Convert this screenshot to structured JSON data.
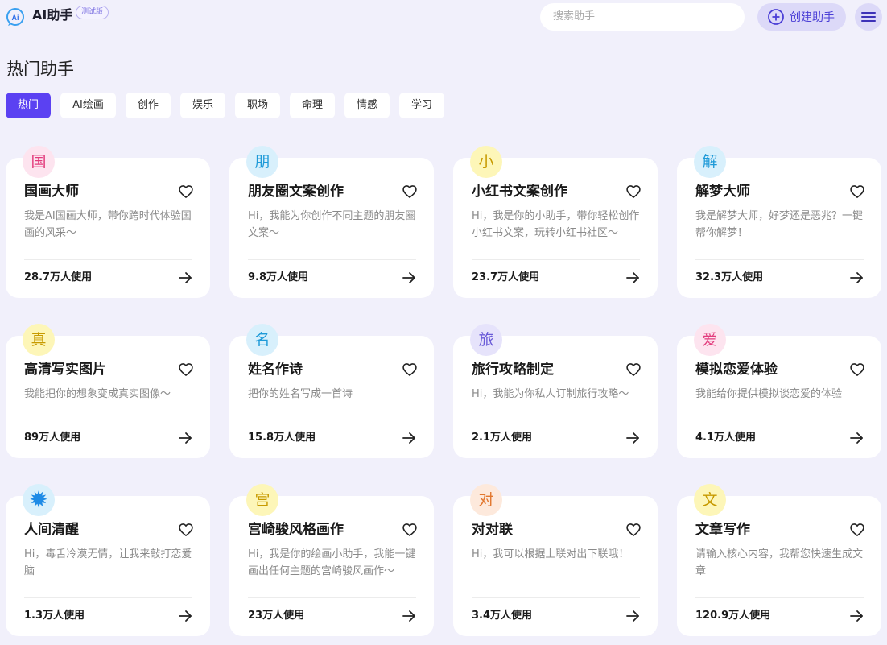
{
  "header": {
    "brand": "AI助手",
    "badge": "测试版",
    "search_placeholder": "搜索助手",
    "create_label": "创建助手"
  },
  "page": {
    "title": "热门助手"
  },
  "tabs": [
    {
      "label": "热门",
      "active": true
    },
    {
      "label": "AI绘画",
      "active": false
    },
    {
      "label": "创作",
      "active": false
    },
    {
      "label": "娱乐",
      "active": false
    },
    {
      "label": "职场",
      "active": false
    },
    {
      "label": "命理",
      "active": false
    },
    {
      "label": "情感",
      "active": false
    },
    {
      "label": "学习",
      "active": false
    }
  ],
  "cards": [
    {
      "avatar": "国",
      "avatar_bg": "#fde4ef",
      "avatar_color": "#e23b7c",
      "title": "国画大师",
      "desc": "我是AI国画大师，带你跨时代体验国画的风采～",
      "usage": "28.7万人使用"
    },
    {
      "avatar": "朋",
      "avatar_bg": "#d8f0fc",
      "avatar_color": "#1e9ad8",
      "title": "朋友圈文案创作",
      "desc": "Hi，我能为你创作不同主题的朋友圈文案～",
      "usage": "9.8万人使用"
    },
    {
      "avatar": "小",
      "avatar_bg": "#fdf6b8",
      "avatar_color": "#c79a00",
      "title": "小红书文案创作",
      "desc": "Hi，我是你的小助手，带你轻松创作小红书文案，玩转小红书社区～",
      "usage": "23.7万人使用"
    },
    {
      "avatar": "解",
      "avatar_bg": "#d8f0fc",
      "avatar_color": "#1e9ad8",
      "title": "解梦大师",
      "desc": "我是解梦大师，好梦还是恶兆？一键帮你解梦！",
      "usage": "32.3万人使用"
    },
    {
      "avatar": "真",
      "avatar_bg": "#fdf6b8",
      "avatar_color": "#c79a00",
      "title": "高清写实图片",
      "desc": "我能把你的想象变成真实图像～",
      "usage": "89万人使用"
    },
    {
      "avatar": "名",
      "avatar_bg": "#d8f0fc",
      "avatar_color": "#1e9ad8",
      "title": "姓名作诗",
      "desc": "把你的姓名写成一首诗",
      "usage": "15.8万人使用"
    },
    {
      "avatar": "旅",
      "avatar_bg": "#e6e3fb",
      "avatar_color": "#6a5bd8",
      "title": "旅行攻略制定",
      "desc": "Hi，我能为你私人订制旅行攻略～",
      "usage": "2.1万人使用"
    },
    {
      "avatar": "爱",
      "avatar_bg": "#fde4ef",
      "avatar_color": "#e23b7c",
      "title": "模拟恋爱体验",
      "desc": "我能给你提供模拟谈恋爱的体验",
      "usage": "4.1万人使用"
    },
    {
      "avatar": "✹",
      "avatar_bg": "#d8f0fc",
      "avatar_color": "#1e8be6",
      "title": "人间清醒",
      "desc": "Hi，毒舌冷漠无情，让我来敲打恋爱脑",
      "usage": "1.3万人使用"
    },
    {
      "avatar": "宫",
      "avatar_bg": "#fdf6b8",
      "avatar_color": "#c79a00",
      "title": "宫崎骏风格画作",
      "desc": "Hi，我是你的绘画小助手，我能一键画出任何主题的宫崎骏风画作～",
      "usage": "23万人使用"
    },
    {
      "avatar": "对",
      "avatar_bg": "#fde9dc",
      "avatar_color": "#e2772e",
      "title": "对对联",
      "desc": "Hi，我可以根据上联对出下联哦！",
      "usage": "3.4万人使用"
    },
    {
      "avatar": "文",
      "avatar_bg": "#fdf6b8",
      "avatar_color": "#c79a00",
      "title": "文章写作",
      "desc": "请输入核心内容，我帮您快速生成文章",
      "usage": "120.9万人使用"
    }
  ]
}
